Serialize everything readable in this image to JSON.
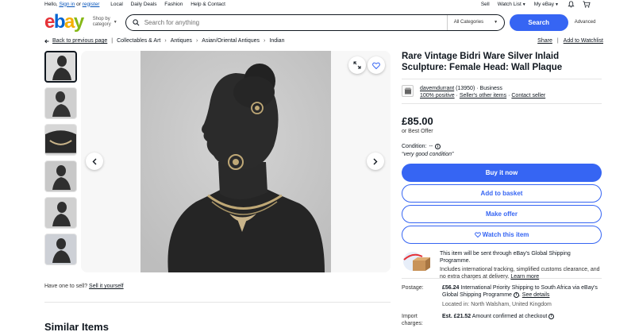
{
  "topbar": {
    "hello": "Hello,",
    "sign_in": "Sign in",
    "or": "or",
    "register": "register",
    "links": [
      "Local",
      "Daily Deals",
      "Fashion",
      "Help & Contact"
    ],
    "sell": "Sell",
    "watch_list": "Watch List",
    "my_ebay": "My eBay"
  },
  "header": {
    "logo": [
      "e",
      "b",
      "a",
      "y"
    ],
    "shop_by_category": [
      "Shop by",
      "category"
    ],
    "search_placeholder": "Search for anything",
    "category_select": "All Categories",
    "search_button": "Search",
    "advanced": "Advanced"
  },
  "breadcrumb": {
    "back": "Back to previous page",
    "items": [
      "Collectables & Art",
      "Antiques",
      "Asian/Oriental Antiques",
      "Indian"
    ],
    "share": "Share",
    "add_watchlist": "Add to Watchlist"
  },
  "gallery": {
    "thumbnail_count": 6,
    "selected_index": 0
  },
  "have_one": {
    "text": "Have one to sell?",
    "link": "Sell it yourself"
  },
  "similar_items": "Similar Items",
  "listing": {
    "title": "Rare Vintage Bidri Ware Silver Inlaid Sculpture: Female Head: Wall Plaque",
    "seller_name": "davemdurrant",
    "seller_feedback": "(13950)",
    "seller_type": "Business",
    "positive": "100% positive",
    "other_items": "Seller's other items",
    "contact": "Contact seller",
    "price": "£85.00",
    "best_offer": "or Best Offer",
    "condition_label": "Condition:",
    "condition_value": "--",
    "condition_note": "“very good condition”",
    "buy_now": "Buy it now",
    "add_basket": "Add to basket",
    "make_offer": "Make offer",
    "watch": "Watch this item",
    "gsp_head": "This item will be sent through eBay's Global Shipping Programme.",
    "gsp_body": "Includes international tracking, simplified customs clearance, and no extra charges at delivery.",
    "gsp_learn": "Learn more"
  },
  "postage": {
    "label": "Postage:",
    "amount": "£56.24",
    "desc": "International Priority Shipping to South Africa via eBay's Global Shipping Programme",
    "see_details": "See details",
    "location": "Located in: North Walsham, United Kingdom",
    "import_label": [
      "Import",
      "charges:"
    ],
    "import_amount": "Est. £21.52",
    "import_desc": "Amount confirmed at checkout"
  }
}
